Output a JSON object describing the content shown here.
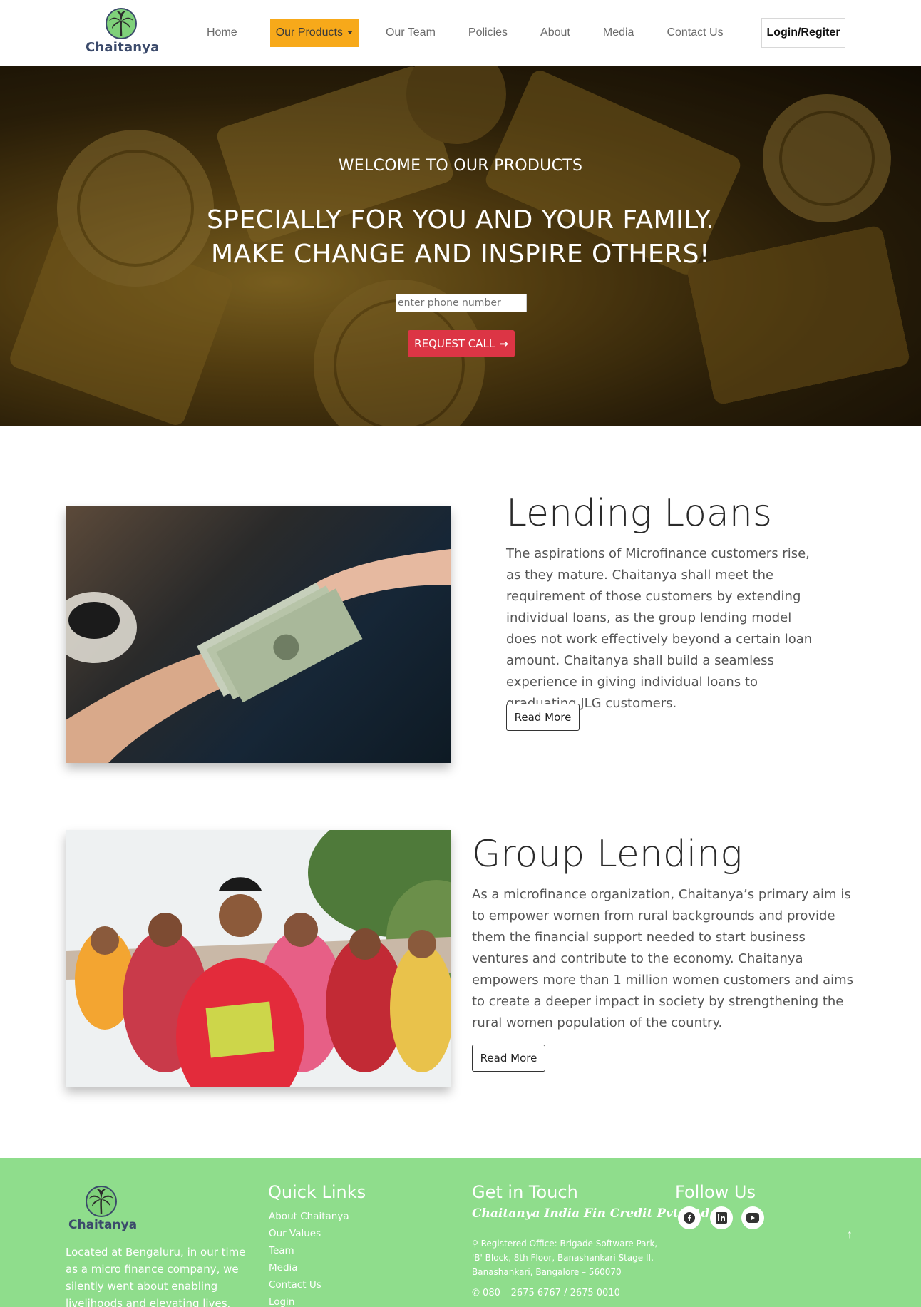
{
  "brand": {
    "name": "Chaitanya"
  },
  "nav": {
    "items": [
      {
        "label": "Home"
      },
      {
        "label": "Our Products"
      },
      {
        "label": "Our Team"
      },
      {
        "label": "Policies"
      },
      {
        "label": "About"
      },
      {
        "label": "Media"
      },
      {
        "label": "Contact Us"
      }
    ],
    "login_label": "Login/Regiter"
  },
  "hero": {
    "subtitle": "WELCOME TO OUR PRODUCTS",
    "title_line1": "SPECIALLY FOR YOU AND YOUR FAMILY.",
    "title_line2": "MAKE CHANGE AND INSPIRE OTHERS!",
    "phone_placeholder": "enter phone number",
    "request_label": "REQUEST CALL"
  },
  "sections": [
    {
      "title": "Lending Loans",
      "text": "The aspirations of Microfinance customers rise, as they mature. Chaitanya shall meet the requirement of those customers by extending individual loans, as the group lending model does not work effectively beyond a certain loan amount. Chaitanya shall build a seamless experience in giving individual loans to graduating JLG customers.",
      "button": "Read More"
    },
    {
      "title": "Group Lending",
      "text": "As a microfinance organization, Chaitanya’s primary aim is to empower women from rural backgrounds and provide them the financial support needed to start business ventures and contribute to the economy. Chaitanya empowers more than 1 million women customers and aims to create a deeper impact in society by strengthening the rural women population of the country.",
      "button": "Read More"
    }
  ],
  "footer": {
    "about": "Located at Bengaluru, in our time as a micro finance company, we silently went about enabling livelihoods and elevating lives.",
    "quick_links_title": "Quick Links",
    "quick_links": [
      "About Chaitanya",
      "Our Values",
      "Team",
      "Media",
      "Contact Us",
      "Login"
    ],
    "get_in_touch_title": "Get in Touch",
    "company": "Chaitanya India Fin Credit Pvt. Ltd.",
    "address": "Registered Office: Brigade Software Park, 'B' Block, 8th Floor, Banashankari Stage II, Banashankari, Bangalore – 560070",
    "phone": "080 – 2675 6767 / 2675 0010",
    "follow_title": "Follow Us",
    "social_icons": [
      "facebook-icon",
      "linkedin-icon",
      "youtube-icon"
    ]
  },
  "colors": {
    "accent": "#f7a91a",
    "request_button": "#dc3545",
    "footer_bg": "#8fdd8c",
    "brand_text": "#3b4a6b"
  }
}
